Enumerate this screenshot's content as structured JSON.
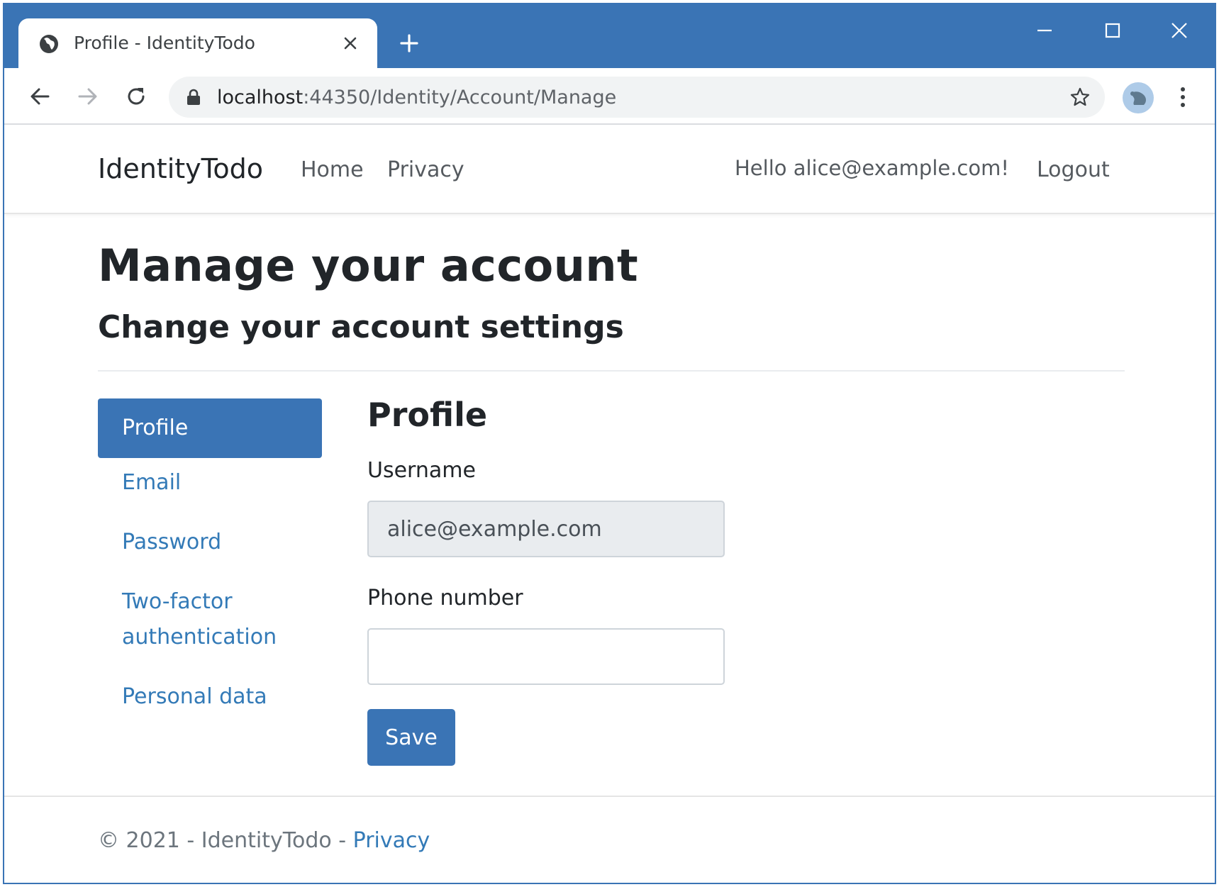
{
  "browser": {
    "tab_title": "Profile - IdentityTodo",
    "url_host": "localhost",
    "url_path": ":44350/Identity/Account/Manage",
    "accent_color": "#3a74b5"
  },
  "navbar": {
    "brand": "IdentityTodo",
    "links": [
      "Home",
      "Privacy"
    ],
    "greeting": "Hello alice@example.com!",
    "logout": "Logout"
  },
  "header": {
    "title": "Manage your account",
    "subtitle": "Change your account settings"
  },
  "sidebar": {
    "items": [
      {
        "label": "Profile",
        "active": true
      },
      {
        "label": "Email",
        "active": false
      },
      {
        "label": "Password",
        "active": false
      },
      {
        "label": "Two-factor",
        "label2": "authentication",
        "active": false
      },
      {
        "label": "Personal data",
        "active": false
      }
    ]
  },
  "form": {
    "heading": "Profile",
    "username_label": "Username",
    "username_value": "alice@example.com",
    "phone_label": "Phone number",
    "phone_value": "",
    "save_label": "Save"
  },
  "footer": {
    "text": "© 2021 - IdentityTodo - ",
    "link": "Privacy"
  }
}
